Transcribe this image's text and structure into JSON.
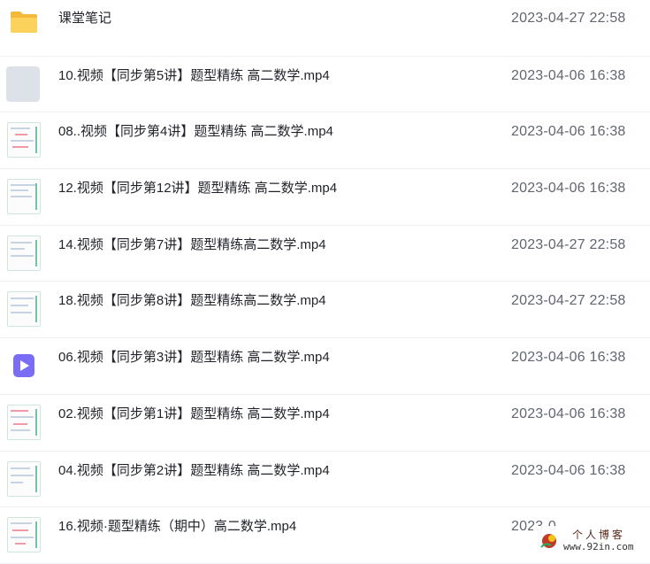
{
  "files": [
    {
      "name": "课堂笔记",
      "time": "2023-04-27 22:58",
      "icon": "folder-icon"
    },
    {
      "name": "10.视频【同步第5讲】题型精练 高二数学.mp4",
      "time": "2023-04-06 16:38",
      "icon": "video-thumbnail"
    },
    {
      "name": "08..视频【同步第4讲】题型精练 高二数学.mp4",
      "time": "2023-04-06 16:38",
      "icon": "video-thumbnail"
    },
    {
      "name": "12.视频【同步第12讲】题型精练 高二数学.mp4",
      "time": "2023-04-06 16:38",
      "icon": "video-thumbnail"
    },
    {
      "name": "14.视频【同步第7讲】题型精练高二数学.mp4",
      "time": "2023-04-27 22:58",
      "icon": "video-thumbnail"
    },
    {
      "name": "18.视频【同步第8讲】题型精练高二数学.mp4",
      "time": "2023-04-27 22:58",
      "icon": "video-thumbnail"
    },
    {
      "name": "06.视频【同步第3讲】题型精练 高二数学.mp4",
      "time": "2023-04-06 16:38",
      "icon": "video-file-icon"
    },
    {
      "name": "02.视频【同步第1讲】题型精练 高二数学.mp4",
      "time": "2023-04-06 16:38",
      "icon": "video-thumbnail"
    },
    {
      "name": "04.视频【同步第2讲】题型精练 高二数学.mp4",
      "time": "2023-04-06 16:38",
      "icon": "video-thumbnail"
    },
    {
      "name": "16.视频·题型精练（期中）高二数学.mp4",
      "time": "2023-0",
      "icon": "video-thumbnail"
    }
  ],
  "watermark": {
    "title": "个人博客",
    "url": "www.92in.com"
  },
  "colors": {
    "folder": "#f7c948",
    "video_icon": "#7b6cf6",
    "text": "#1f2329",
    "time": "#606770"
  }
}
